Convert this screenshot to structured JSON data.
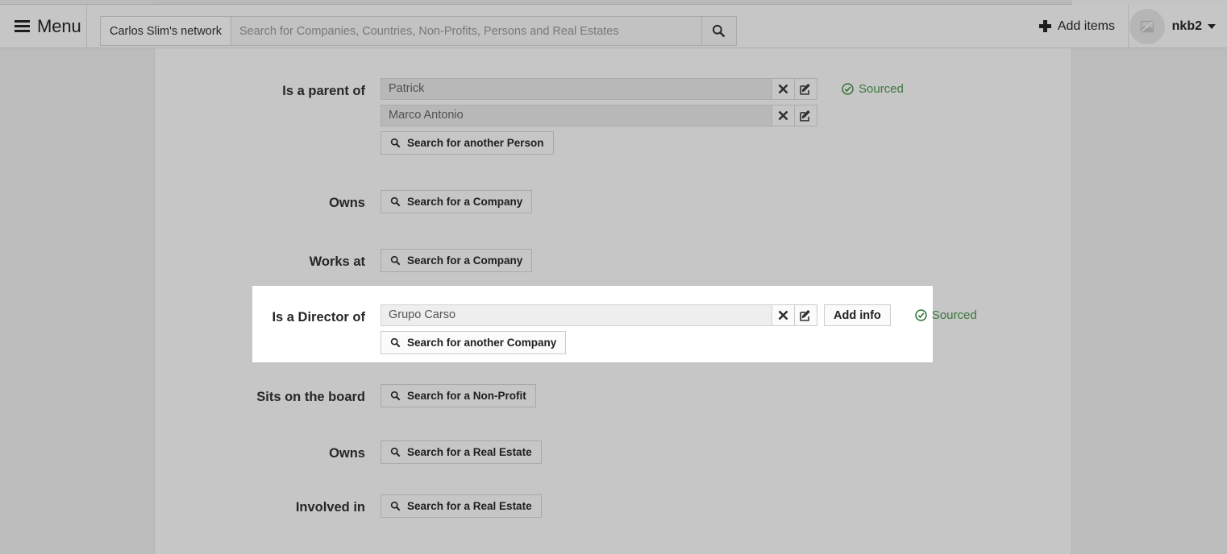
{
  "navbar": {
    "menu_label": "Menu",
    "menu_icon": "hamburger-icon",
    "network_tag": "Carlos Slim's network",
    "search_placeholder": "Search for Companies, Countries, Non-Profits, Persons and Real Estates",
    "search_value": "",
    "search_icon": "search-icon",
    "add_items_label": "Add items",
    "add_items_icon": "plus-icon",
    "avatar_icon": "broken-image-icon",
    "user_name": "nkb2",
    "caret_icon": "caret-down-icon"
  },
  "colors": {
    "page_bg": "#bcbcbc",
    "panel_bg": "#c6c6c6",
    "navbar_bg": "#c6c6c6",
    "highlight_bg": "#ffffff",
    "sourced_green": "#3c763d",
    "text": "#262626",
    "input_bg": "#b8b8b8",
    "input_bg_light": "#eeeeee"
  },
  "labels": {
    "sourced": "Sourced",
    "sourced_icon": "check-circle-icon",
    "clear_icon": "times-icon",
    "edit_icon": "pencil-square-icon",
    "search_icon": "search-icon",
    "add_info": "Add info"
  },
  "rows": [
    {
      "label": "Is a parent of",
      "entities": [
        {
          "value": "Patrick",
          "has_add_info": false,
          "sourced": true
        },
        {
          "value": "Marco Antonio",
          "has_add_info": false,
          "sourced": false
        }
      ],
      "search_button": "Search for another Person",
      "highlighted": false
    },
    {
      "label": "Owns",
      "entities": [],
      "search_button": "Search for a Company",
      "highlighted": false
    },
    {
      "label": "Works at",
      "entities": [],
      "search_button": "Search for a Company",
      "highlighted": false
    },
    {
      "label": "Is a Director of",
      "entities": [
        {
          "value": "Grupo Carso",
          "has_add_info": true,
          "sourced": true
        }
      ],
      "search_button": "Search for another Company",
      "highlighted": true
    },
    {
      "label": "Sits on the board",
      "entities": [],
      "search_button": "Search for a Non-Profit",
      "highlighted": false
    },
    {
      "label": "Owns",
      "entities": [],
      "search_button": "Search for a Real Estate",
      "highlighted": false
    },
    {
      "label": "Involved in",
      "entities": [],
      "search_button": "Search for a Real Estate",
      "highlighted": false
    }
  ]
}
